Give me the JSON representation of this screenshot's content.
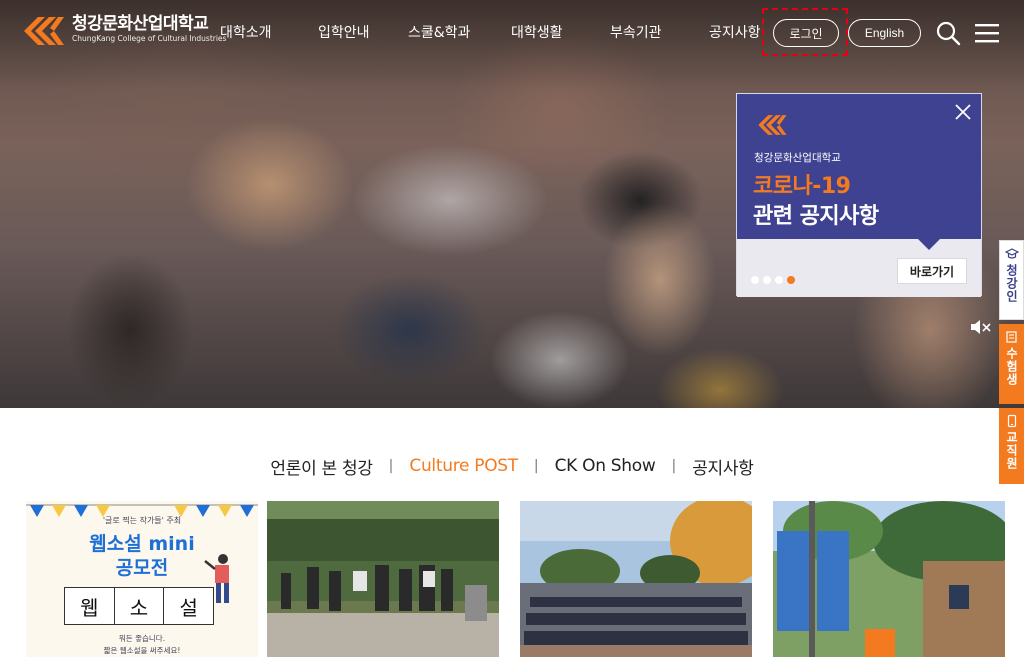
{
  "header": {
    "logo_ko": "청강문화산업대학교",
    "logo_en": "ChungKang College of Cultural Industries",
    "nav": [
      "대학소개",
      "입학안내",
      "스쿨&학과",
      "대학생활",
      "부속기관",
      "공지사항"
    ],
    "login_label": "로그인",
    "english_label": "English",
    "search_icon": "search-icon",
    "menu_icon": "hamburger-menu-icon"
  },
  "popup": {
    "school": "청강문화산업대학교",
    "title_line1": "코로나-19",
    "title_line2": "관련 공지사항",
    "go_label": "바로가기",
    "dots_total": 4,
    "dots_active": 4
  },
  "quick_tabs": [
    {
      "label": "청강인",
      "icon": "graduation-cap-icon"
    },
    {
      "label": "수험생",
      "icon": "pencil-note-icon"
    },
    {
      "label": "교직원",
      "icon": "phone-icon"
    }
  ],
  "content_tabs": [
    {
      "label": "언론이 본 청강",
      "active": false
    },
    {
      "label": "Culture POST",
      "active": true
    },
    {
      "label": "CK On Show",
      "active": false
    },
    {
      "label": "공지사항",
      "active": false
    }
  ],
  "thumbnails": {
    "poster": {
      "subtitle": "'글로 찍는 작가들' 주최",
      "title_line1": "웹소설 mini",
      "title_line2": "공모전",
      "cells": [
        "웹",
        "소",
        "설"
      ],
      "tiny1": "뭐든 좋습니다.",
      "tiny2": "짧은 웹소설을 써주세요!"
    }
  },
  "colors": {
    "brand_orange": "#f47a20",
    "brand_navy": "#3c3f8a",
    "highlight_red": "#e60012"
  }
}
